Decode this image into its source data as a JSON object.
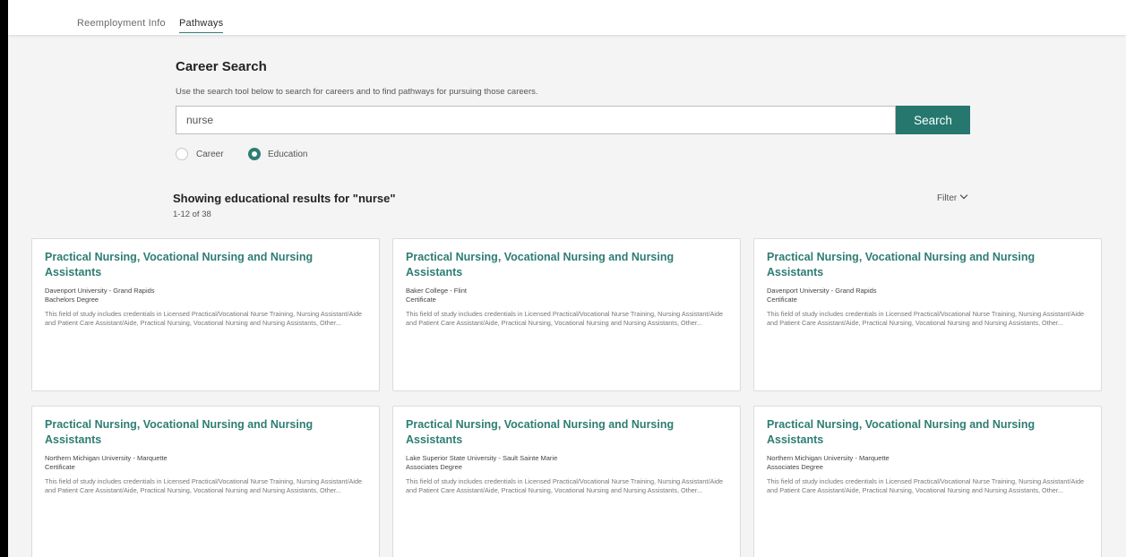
{
  "tabs": [
    {
      "label": "Reemployment Info",
      "active": false
    },
    {
      "label": "Pathways",
      "active": true
    }
  ],
  "search": {
    "title": "Career Search",
    "subtitle": "Use the search tool below to search for careers and to find pathways for pursuing those careers.",
    "query": "nurse",
    "button_label": "Search",
    "options": [
      {
        "label": "Career",
        "selected": false
      },
      {
        "label": "Education",
        "selected": true
      }
    ]
  },
  "results": {
    "heading": "Showing educational results for \"nurse\"",
    "count": "1-12 of 38",
    "filter_label": "Filter",
    "filter_icon": "chevron-down-icon"
  },
  "cards": [
    {
      "title": "Practical Nursing, Vocational Nursing and Nursing Assistants",
      "school": "Davenport University - Grand Rapids",
      "degree": "Bachelors Degree",
      "description": "This field of study includes credentials in Licensed Practical/Vocational Nurse Training, Nursing Assistant/Aide and Patient Care Assistant/Aide, Practical Nursing, Vocational Nursing and Nursing Assistants, Other..."
    },
    {
      "title": "Practical Nursing, Vocational Nursing and Nursing Assistants",
      "school": "Baker College - Flint",
      "degree": "Certificate",
      "description": "This field of study includes credentials in Licensed Practical/Vocational Nurse Training, Nursing Assistant/Aide and Patient Care Assistant/Aide, Practical Nursing, Vocational Nursing and Nursing Assistants, Other..."
    },
    {
      "title": "Practical Nursing, Vocational Nursing and Nursing Assistants",
      "school": "Davenport University - Grand Rapids",
      "degree": "Certificate",
      "description": "This field of study includes credentials in Licensed Practical/Vocational Nurse Training, Nursing Assistant/Aide and Patient Care Assistant/Aide, Practical Nursing, Vocational Nursing and Nursing Assistants, Other..."
    },
    {
      "title": "Practical Nursing, Vocational Nursing and Nursing Assistants",
      "school": "Northern Michigan University - Marquette",
      "degree": "Certificate",
      "description": "This field of study includes credentials in Licensed Practical/Vocational Nurse Training, Nursing Assistant/Aide and Patient Care Assistant/Aide, Practical Nursing, Vocational Nursing and Nursing Assistants, Other..."
    },
    {
      "title": "Practical Nursing, Vocational Nursing and Nursing Assistants",
      "school": "Lake Superior State University - Sault Sainte Marie",
      "degree": "Associates Degree",
      "description": "This field of study includes credentials in Licensed Practical/Vocational Nurse Training, Nursing Assistant/Aide and Patient Care Assistant/Aide, Practical Nursing, Vocational Nursing and Nursing Assistants, Other..."
    },
    {
      "title": "Practical Nursing, Vocational Nursing and Nursing Assistants",
      "school": "Northern Michigan University - Marquette",
      "degree": "Associates Degree",
      "description": "This field of study includes credentials in Licensed Practical/Vocational Nurse Training, Nursing Assistant/Aide and Patient Care Assistant/Aide, Practical Nursing, Vocational Nursing and Nursing Assistants, Other..."
    }
  ],
  "colors": {
    "accent": "#2e7d74",
    "button": "#26786f",
    "background": "#f4f4f4"
  }
}
